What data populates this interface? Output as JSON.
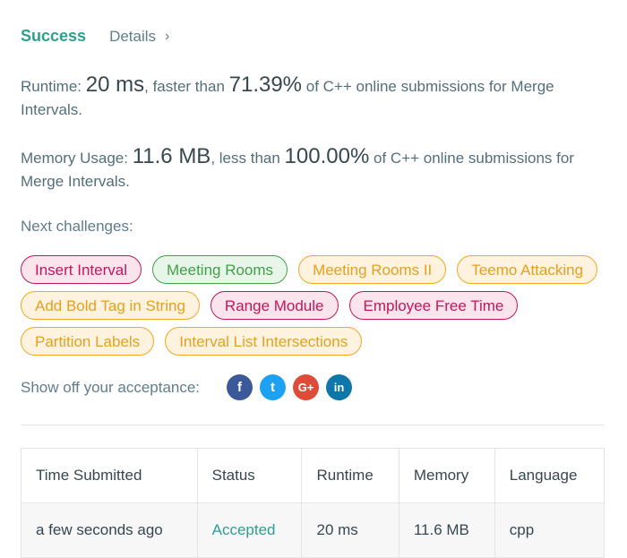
{
  "header": {
    "status": "Success",
    "details_label": "Details",
    "details_chevron": "›"
  },
  "runtime": {
    "label": "Runtime:",
    "value": "20 ms",
    "mid": ", faster than ",
    "percent": "71.39%",
    "suffix": " of C++ online submissions for Merge Intervals."
  },
  "memory": {
    "label": "Memory Usage:",
    "value": "11.6 MB",
    "mid": ", less than ",
    "percent": "100.00%",
    "suffix": " of C++ online submissions for Merge Intervals."
  },
  "next": {
    "label": "Next challenges:",
    "tags": [
      {
        "label": "Insert Interval",
        "difficulty": "hard"
      },
      {
        "label": "Meeting Rooms",
        "difficulty": "easy"
      },
      {
        "label": "Meeting Rooms II",
        "difficulty": "medium"
      },
      {
        "label": "Teemo Attacking",
        "difficulty": "medium"
      },
      {
        "label": "Add Bold Tag in String",
        "difficulty": "medium"
      },
      {
        "label": "Range Module",
        "difficulty": "hard"
      },
      {
        "label": "Employee Free Time",
        "difficulty": "hard"
      },
      {
        "label": "Partition Labels",
        "difficulty": "medium"
      },
      {
        "label": "Interval List Intersections",
        "difficulty": "medium"
      }
    ]
  },
  "share": {
    "label": "Show off your acceptance:",
    "icons": [
      {
        "name": "facebook-icon",
        "glyph": "f"
      },
      {
        "name": "twitter-icon",
        "glyph": "t"
      },
      {
        "name": "google-plus-icon",
        "glyph": "G+"
      },
      {
        "name": "linkedin-icon",
        "glyph": "in"
      }
    ]
  },
  "table": {
    "headers": [
      "Time Submitted",
      "Status",
      "Runtime",
      "Memory",
      "Language"
    ],
    "rows": [
      [
        "a few seconds ago",
        "Accepted",
        "20 ms",
        "11.6 MB",
        "cpp"
      ]
    ]
  },
  "colors": {
    "accent": "#2e9f8f",
    "hard": "#c2185b",
    "easy": "#43a047",
    "medium": "#f5a623"
  }
}
